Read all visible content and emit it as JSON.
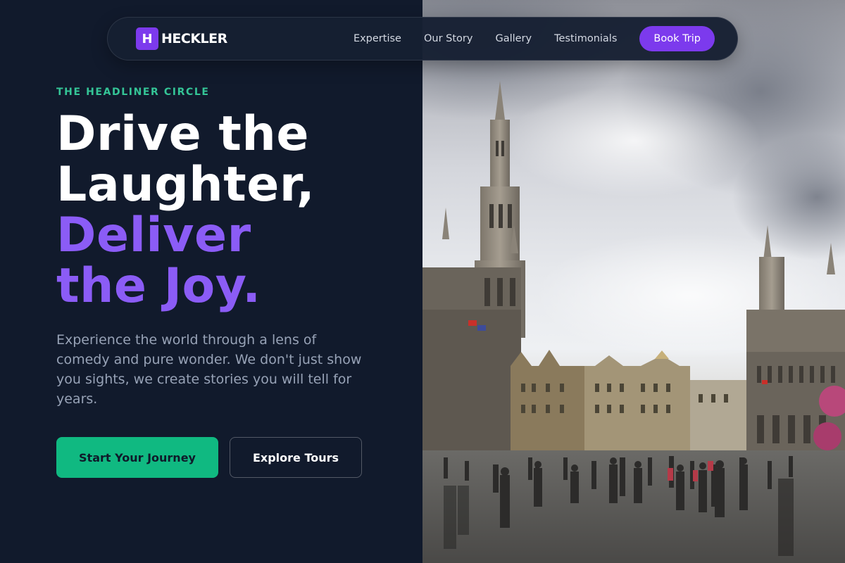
{
  "brand": {
    "mark": "H",
    "name": "HECKLER"
  },
  "nav": {
    "links": [
      "Expertise",
      "Our Story",
      "Gallery",
      "Testimonials"
    ],
    "cta": "Book Trip"
  },
  "hero": {
    "eyebrow": "THE HEADLINER CIRCLE",
    "headline": {
      "line1": "Drive the",
      "line2": "Laughter,",
      "line3": "Deliver",
      "line4": "the Joy."
    },
    "description": "Experience the world through a lens of comedy and pure wonder. We don't just show you sights, we create stories you will tell for years.",
    "primary_button": "Start Your Journey",
    "secondary_button": "Explore Tours"
  },
  "photo": {
    "subject": "Grand-Place square with gothic tower and crowd under cloudy sky"
  },
  "colors": {
    "background": "#111a2c",
    "accent_purple": "#7c3aed",
    "headline_purple": "#8b5cf6",
    "accent_green": "#10b981",
    "eyebrow_green": "#34c496"
  }
}
